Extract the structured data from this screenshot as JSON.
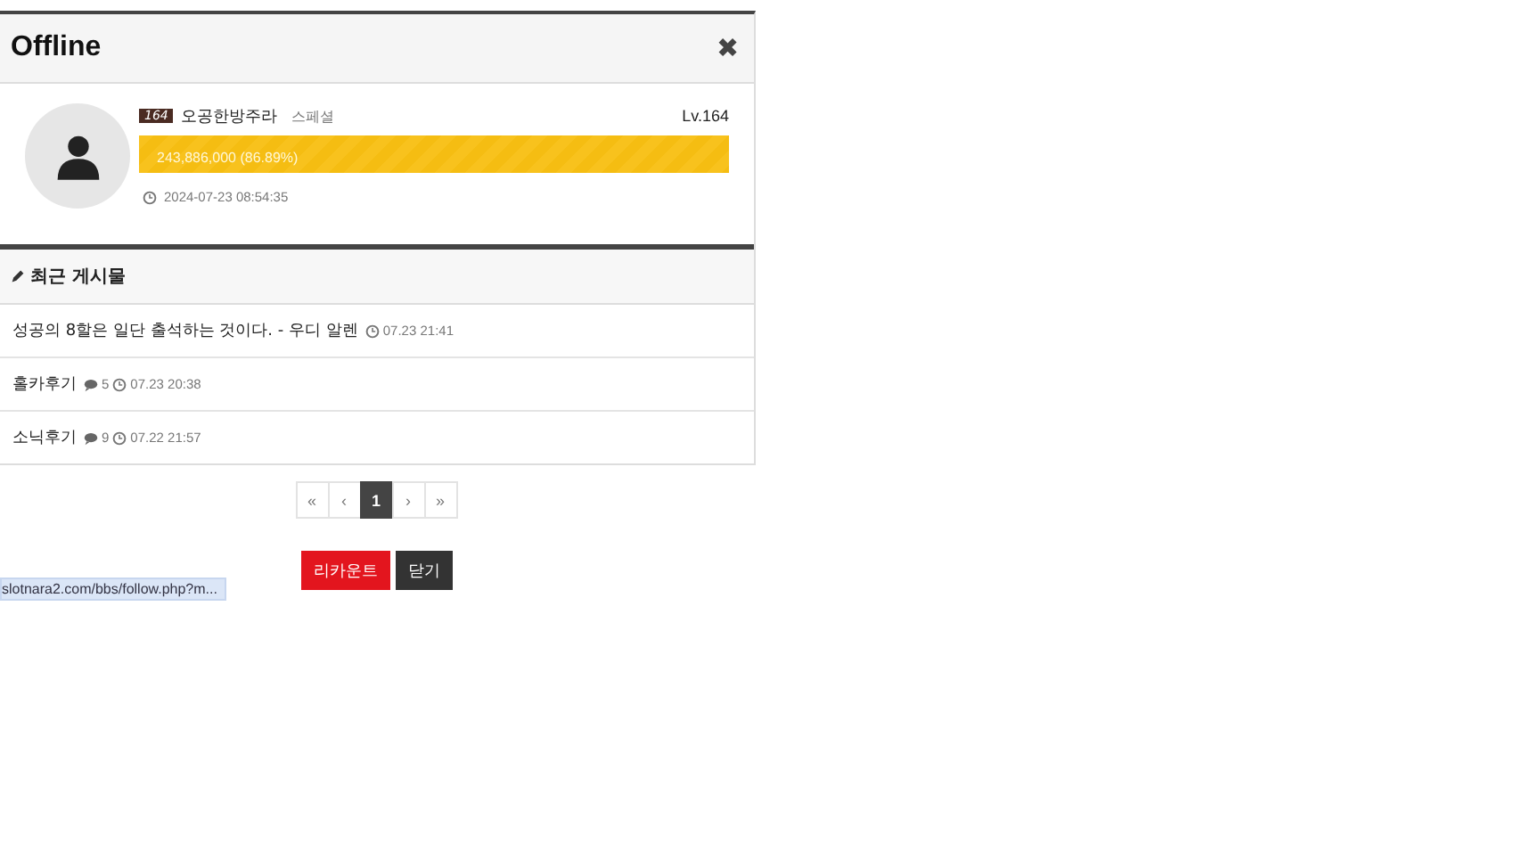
{
  "header": {
    "title": "Offline",
    "close": "✖"
  },
  "profile": {
    "badge": "164",
    "name": "오공한방주라",
    "tag": "스페셜",
    "level_text": "Lv.164",
    "exp": {
      "text": "243,886,000 (86.89%)",
      "level": 1
    },
    "last_seen": "2024-07-23 08:54:35"
  },
  "recent_posts": {
    "title": "최근 게시물",
    "posts": [
      {
        "title": "성공의 8할은 일단 출석하는 것이다. - 우디 알렌",
        "time": "07.23 21:41"
      },
      {
        "title": "홀카후기",
        "comments": "5",
        "time": "07.23 20:38"
      },
      {
        "title": "소닉후기",
        "comments": "9",
        "time": "07.22 21:57"
      }
    ]
  },
  "pagination": [
    {
      "label": "«",
      "selected": false
    },
    {
      "label": "‹",
      "selected": false
    },
    {
      "label": "1",
      "selected": true
    },
    {
      "label": "›",
      "selected": false
    },
    {
      "label": "»",
      "selected": false
    }
  ],
  "buttons": [
    {
      "label": "리카운트",
      "kind": "primary"
    },
    {
      "label": "닫기",
      "kind": "dark"
    }
  ],
  "status_url": "slotnara2.com/bbs/follow.php?m..."
}
